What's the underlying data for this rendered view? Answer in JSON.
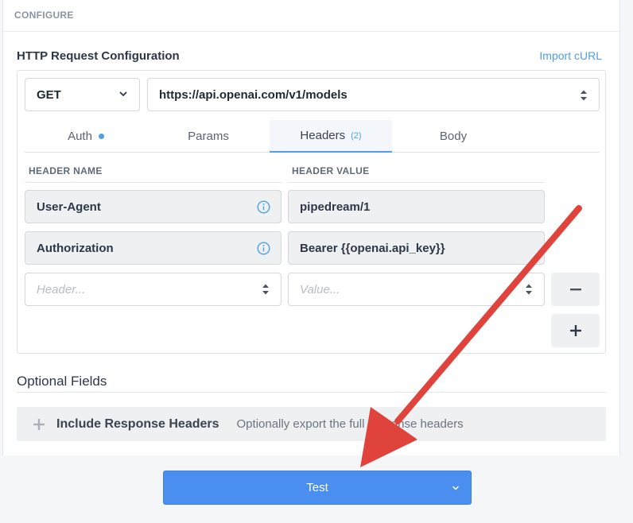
{
  "configure": {
    "label": "CONFIGURE"
  },
  "http": {
    "title": "HTTP Request Configuration",
    "import_label": "Import cURL",
    "method": "GET",
    "url": "https://api.openai.com/v1/models"
  },
  "tabs": [
    {
      "label": "Auth",
      "indicator": "dot"
    },
    {
      "label": "Params"
    },
    {
      "label": "Headers",
      "count": "(2)",
      "active": true
    },
    {
      "label": "Body"
    }
  ],
  "headers": {
    "name_col": "HEADER NAME",
    "value_col": "HEADER VALUE",
    "rows": [
      {
        "name": "User-Agent",
        "value": "pipedream/1"
      },
      {
        "name": "Authorization",
        "value": "Bearer {{openai.api_key}}"
      }
    ],
    "name_placeholder": "Header...",
    "value_placeholder": "Value...",
    "remove_symbol": "−",
    "add_symbol": "+"
  },
  "optional": {
    "title": "Optional Fields",
    "field_label": "Include Response Headers",
    "field_desc": "Optionally export the full response headers"
  },
  "test": {
    "label": "Test"
  },
  "colors": {
    "accent": "#4f9fe8",
    "button": "#4a8ff0",
    "annotation_arrow": "#e0433b"
  }
}
